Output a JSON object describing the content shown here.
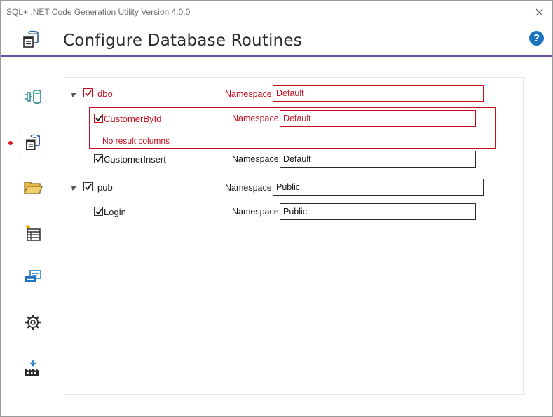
{
  "window": {
    "title": "SQL+ .NET Code Generation Utility Version 4.0.0"
  },
  "header": {
    "title": "Configure Database Routines",
    "help_label": "?"
  },
  "nav": [
    {
      "name": "connection",
      "icon": "plug-database-icon",
      "active": false
    },
    {
      "name": "routines",
      "icon": "database-routines-icon",
      "active": true
    },
    {
      "name": "folders",
      "icon": "folder-open-icon",
      "active": false
    },
    {
      "name": "queries",
      "icon": "table-new-icon",
      "active": false
    },
    {
      "name": "messages",
      "icon": "message-card-icon",
      "active": false
    },
    {
      "name": "settings",
      "icon": "gear-icon",
      "active": false
    },
    {
      "name": "build",
      "icon": "build-download-icon",
      "active": false
    }
  ],
  "tree": {
    "namespace_label": "Namespace:",
    "schemas": [
      {
        "name": "dbo",
        "checked": true,
        "error": true,
        "namespace": "Default",
        "routines": [
          {
            "name": "CustomerById",
            "checked": true,
            "error": true,
            "namespace": "Default",
            "error_message": "No result columns"
          },
          {
            "name": "CustomerInsert",
            "checked": true,
            "error": false,
            "namespace": "Default"
          }
        ]
      },
      {
        "name": "pub",
        "checked": true,
        "error": false,
        "namespace": "Public",
        "routines": [
          {
            "name": "Login",
            "checked": true,
            "error": false,
            "namespace": "Public"
          }
        ]
      }
    ]
  },
  "colors": {
    "accent": "#6b4e9b",
    "error": "#c50f1f",
    "help": "#1e73be",
    "active_nav": "#3f8a3f"
  }
}
